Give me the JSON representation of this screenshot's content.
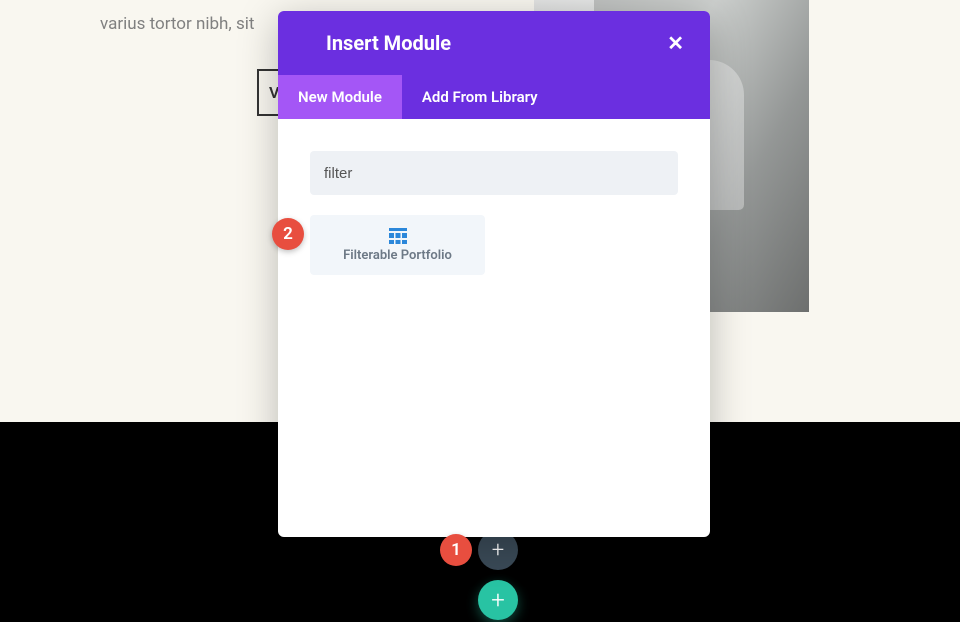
{
  "background": {
    "body_text": "varius tortor nibh, sit",
    "button_partial": "V"
  },
  "modal": {
    "title": "Insert Module",
    "close_glyph": "✕",
    "tabs": {
      "new_module": "New Module",
      "add_from_library": "Add From Library"
    },
    "search_value": "filter",
    "modules": {
      "filterable_portfolio": "Filterable Portfolio"
    }
  },
  "buttons": {
    "add_row_plus": "+",
    "add_section_plus": "+"
  },
  "annotations": {
    "one": "1",
    "two": "2"
  }
}
